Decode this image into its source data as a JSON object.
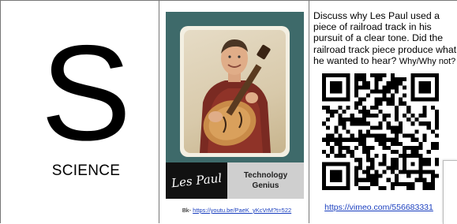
{
  "column1": {
    "letter": "S",
    "subject": "SCIENCE"
  },
  "card": {
    "signature": "Les Paul",
    "title_line1": "Technology",
    "title_line2": "Genius",
    "bk_prefix": "Bk- ",
    "bk_link": "https://youtu.be/PaeK_yKcVrM?t=522"
  },
  "column3": {
    "prompt_main": "Discuss why Les Paul used a piece of railroad track in his pursuit of a clear tone. Did the railroad track piece produce what he wanted to hear?",
    "prompt_why": "Why/Why not?",
    "qr_icon": "qr-code",
    "vimeo_link": "https://vimeo.com/556683331"
  },
  "colors": {
    "card_bg": "#3e6a6a",
    "link": "#1a3fbf",
    "grid": "#777777"
  }
}
